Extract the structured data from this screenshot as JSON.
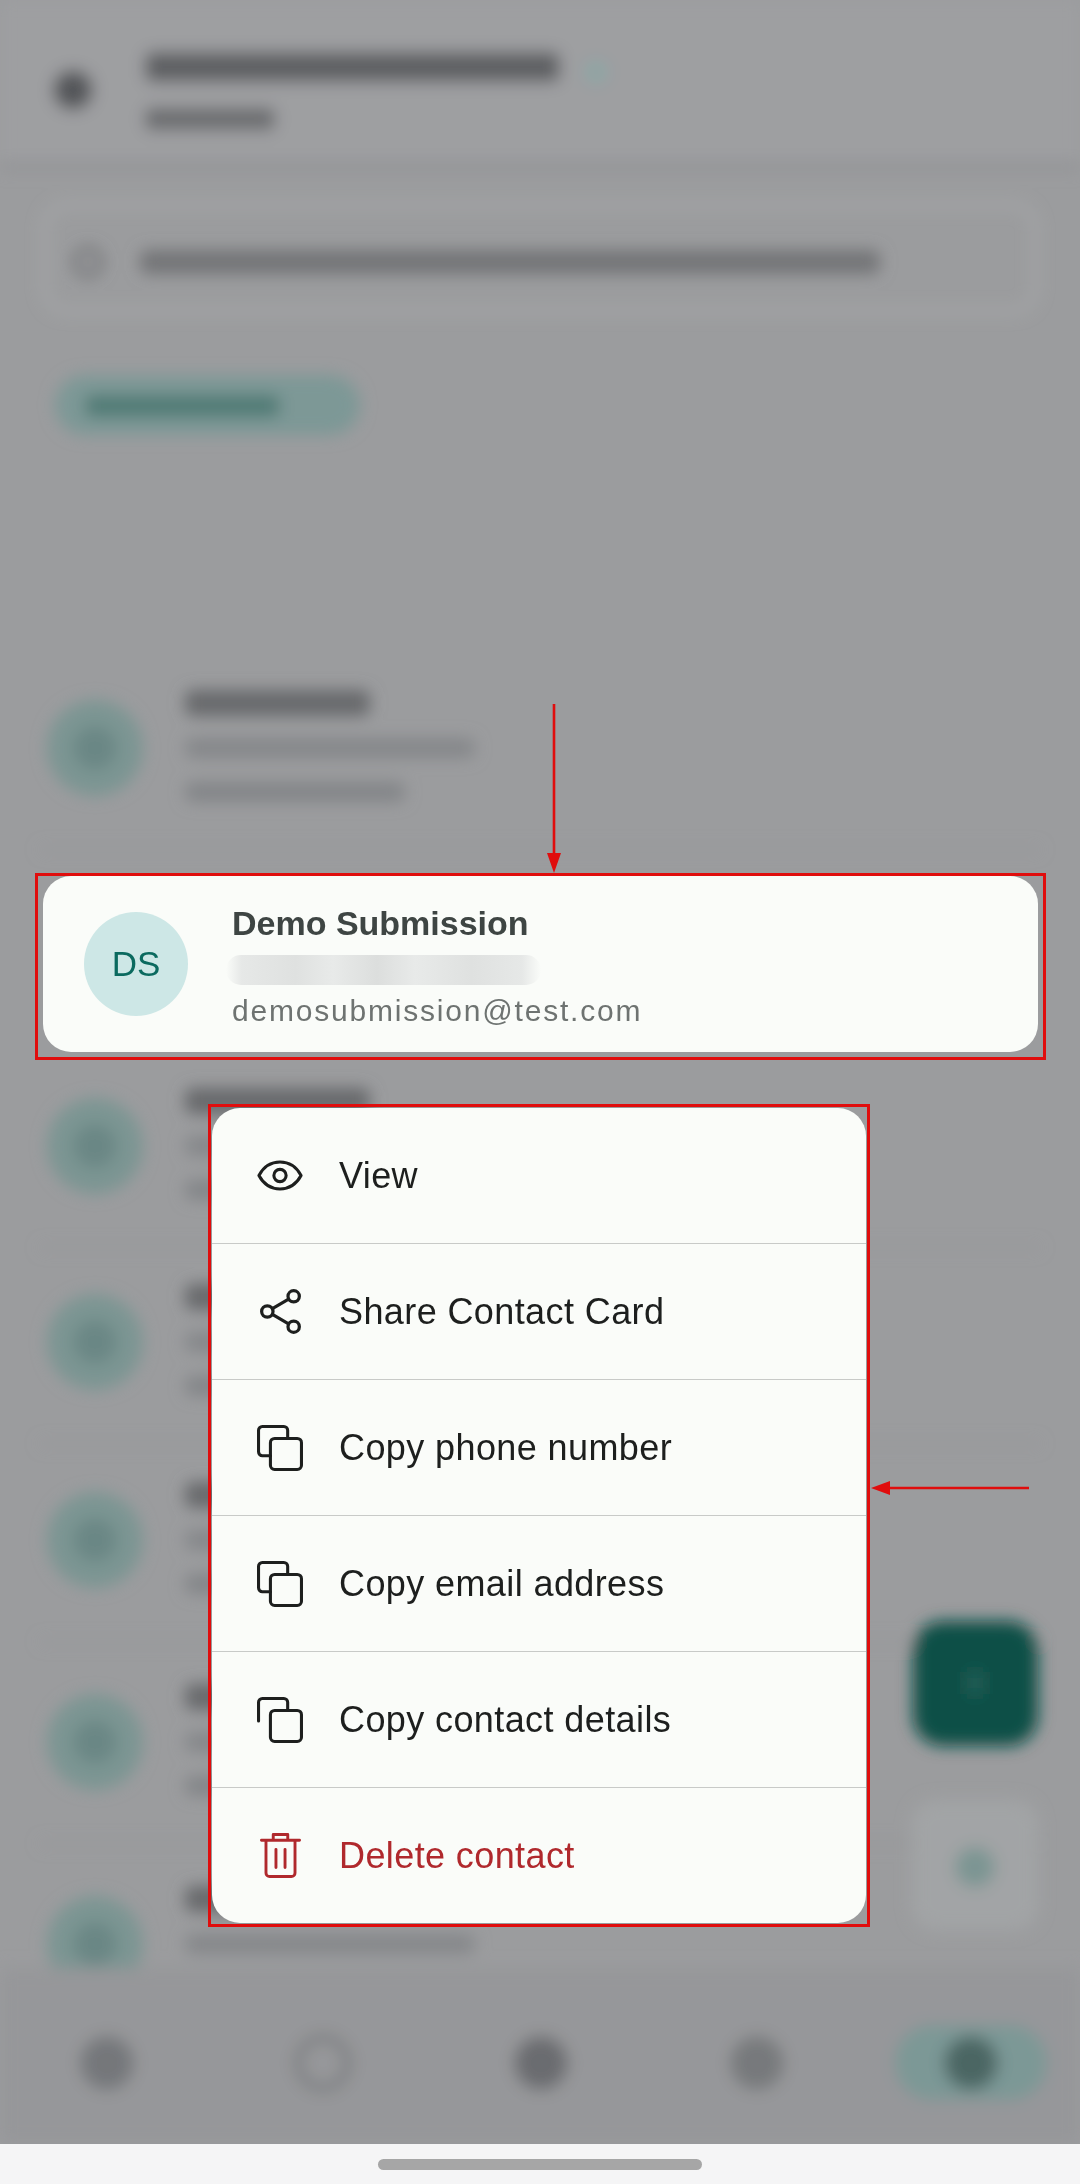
{
  "background": {
    "blurred": true
  },
  "contact_card": {
    "initials": "DS",
    "name": "Demo Submission",
    "phone_blurred": true,
    "email": "demosubmission@test.com",
    "outlined": true,
    "arrow_above": true
  },
  "context_menu": {
    "outlined": true,
    "arrow_right": true,
    "items": [
      {
        "kind": "view",
        "label": "View"
      },
      {
        "kind": "share",
        "label": "Share Contact Card"
      },
      {
        "kind": "copy",
        "label": "Copy phone number"
      },
      {
        "kind": "copy",
        "label": "Copy email address"
      },
      {
        "kind": "copyall",
        "label": "Copy contact details"
      },
      {
        "kind": "delete",
        "label": "Delete contact"
      }
    ]
  }
}
